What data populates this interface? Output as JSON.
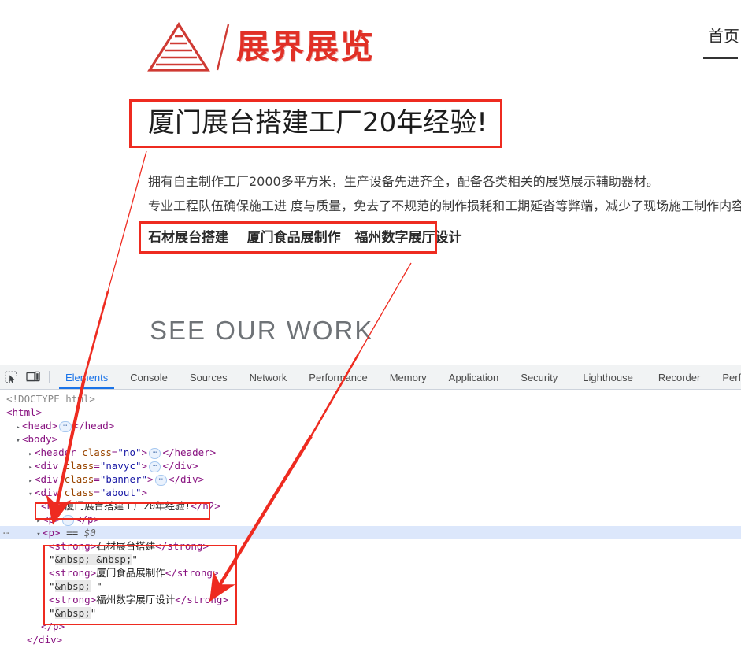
{
  "webpage": {
    "logo": {
      "icon": "pyramid-logo-icon",
      "slash": "slash-divider-icon",
      "text": "展界展览",
      "color": "#e13026"
    },
    "nav": {
      "items": [
        "首页"
      ]
    },
    "about": {
      "heading": "厦门展台搭建工厂20年经验!",
      "paragraph_line1": "拥有自主制作工厂2000多平方米，生产设备先进齐全，配备各类相关的展览展示辅助器材。",
      "paragraph_line2": "专业工程队伍确保施工进 度与质量，免去了不规范的制作损耗和工期延沓等弊端，减少了现场施工制作内容",
      "strong_links": [
        "石材展台搭建",
        "厦门食品展制作",
        "福州数字展厅设计"
      ]
    },
    "section_title": "SEE OUR WORK"
  },
  "devtools": {
    "toolbar": {
      "inspect_icon": "inspect-element-icon",
      "device_icon": "device-toolbar-icon",
      "tabs": [
        {
          "label": "Elements",
          "selected": true
        },
        {
          "label": "Console",
          "selected": false
        },
        {
          "label": "Sources",
          "selected": false
        },
        {
          "label": "Network",
          "selected": false
        },
        {
          "label": "Performance",
          "selected": false
        },
        {
          "label": "Memory",
          "selected": false
        },
        {
          "label": "Application",
          "selected": false
        },
        {
          "label": "Security",
          "selected": false
        },
        {
          "label": "Lighthouse",
          "selected": false
        },
        {
          "label": "Recorder",
          "selected": false
        },
        {
          "label": "Performa",
          "selected": false
        }
      ]
    },
    "dom": {
      "doctype": "<!DOCTYPE html>",
      "html_open": "<html>",
      "head_row": {
        "tag": "head",
        "collapsed_pill": "⋯",
        "close": "</head>"
      },
      "body_open": "<body>",
      "header_row": {
        "open": "<header class=\"no\">",
        "close": "</header>",
        "class_name": "no"
      },
      "navyc_row": {
        "open": "<div class=\"navyc\">",
        "close": "</div>",
        "class_name": "navyc"
      },
      "banner_row": {
        "open": "<div class=\"banner\">",
        "close": "</div>",
        "class_name": "banner"
      },
      "about_row": {
        "open": "<div class=\"about\">",
        "class_name": "about"
      },
      "h2_row": "<h2>厦门展台搭建工厂20年经验!</h2>",
      "p_collapsed": {
        "open": "<p>",
        "close": "</p>"
      },
      "p_selected": {
        "open": "<p>",
        "eq": "==",
        "dollar": "$0"
      },
      "strong1": {
        "open": "<strong>",
        "text": "石材展台搭建",
        "close": "</strong>"
      },
      "entity1": "\"&nbsp; &nbsp;\"",
      "strong2": {
        "open": "<strong>",
        "text": "厦门食品展制作",
        "close": "</strong>"
      },
      "entity2": "\"&nbsp; \"",
      "strong3": {
        "open": "<strong>",
        "text": "福州数字展厅设计",
        "close": "</strong>"
      },
      "entity3": "\"&nbsp;\"",
      "p_close": "</p>",
      "div_close": "</div>"
    }
  },
  "annotations": {
    "accent_color": "#ee2b20",
    "boxes": [
      {
        "name": "heading-highlight-box"
      },
      {
        "name": "strong-links-highlight-box"
      },
      {
        "name": "h2-dom-row-highlight-box"
      },
      {
        "name": "strong-dom-rows-highlight-box"
      }
    ],
    "arrows": [
      {
        "name": "heading-to-h2-arrow"
      },
      {
        "name": "strong-links-to-dom-arrow"
      }
    ]
  }
}
